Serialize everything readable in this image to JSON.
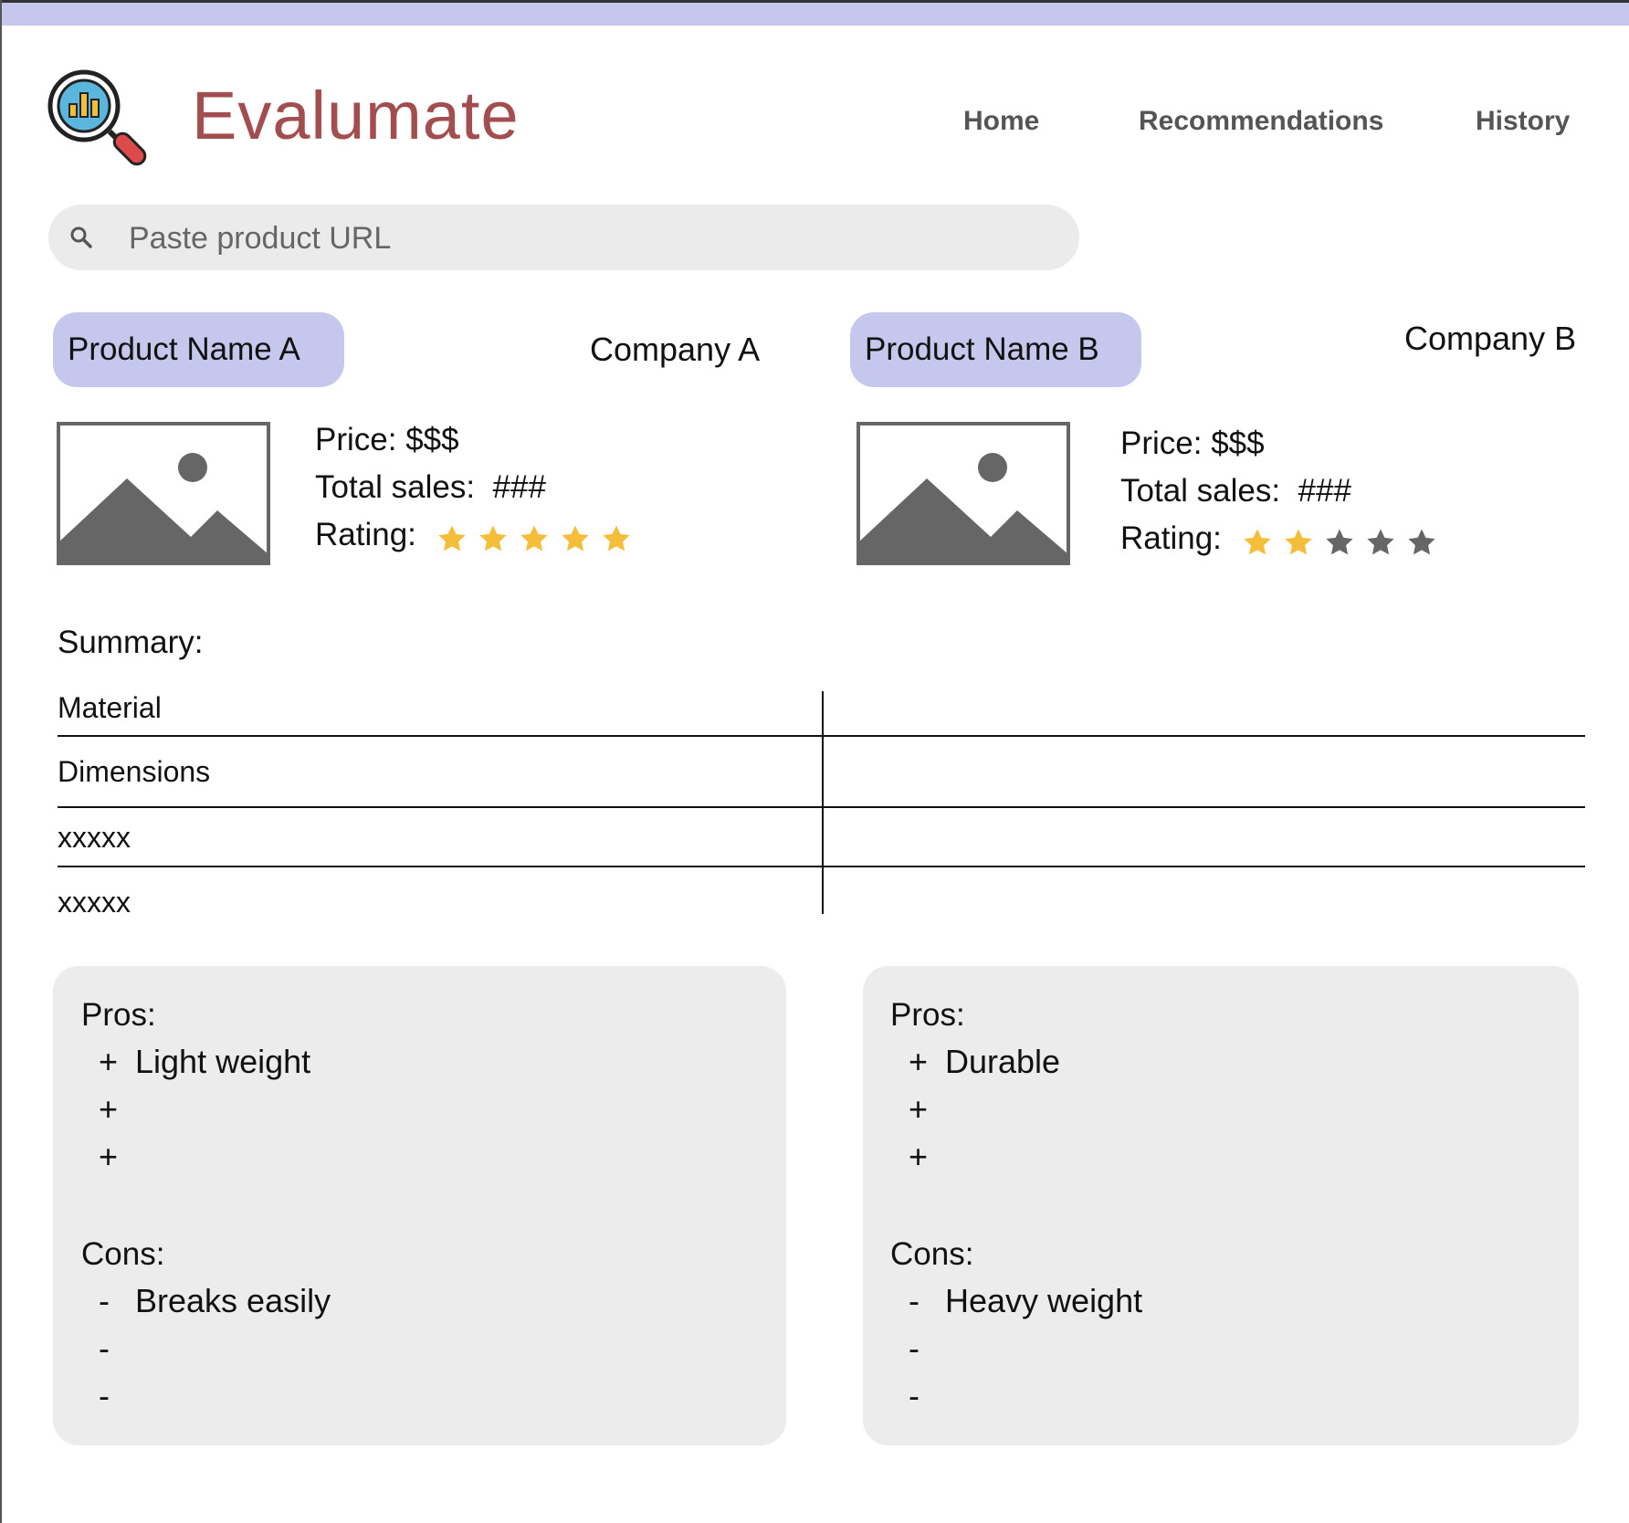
{
  "app": {
    "name": "Evalumate",
    "logo_icon": "magnifier-chart-icon",
    "brand_color": "#a34e4e",
    "accent_color": "#c5c8ec"
  },
  "nav": {
    "home": "Home",
    "recommendations": "Recommendations",
    "history": "History"
  },
  "search": {
    "placeholder": "Paste product URL",
    "value": ""
  },
  "products": [
    {
      "name": "Product Name A",
      "company": "Company A",
      "price_label": "Price:",
      "price": "$$$",
      "sales_label": "Total sales:",
      "sales": "###",
      "rating_label": "Rating:",
      "rating": 5,
      "rating_max": 5
    },
    {
      "name": "Product Name B",
      "company": "Company B",
      "price_label": "Price:",
      "price": "$$$",
      "sales_label": "Total sales:",
      "sales": "###",
      "rating_label": "Rating:",
      "rating": 2,
      "rating_max": 5
    }
  ],
  "summary": {
    "title": "Summary:",
    "rows": [
      "Material",
      "Dimensions",
      "xxxxx",
      "xxxxx"
    ]
  },
  "cards": [
    {
      "pros_title": "Pros:",
      "pros": [
        "Light weight",
        "",
        ""
      ],
      "cons_title": "Cons:",
      "cons": [
        "Breaks easily",
        "",
        ""
      ]
    },
    {
      "pros_title": "Pros:",
      "pros": [
        "Durable",
        "",
        ""
      ],
      "cons_title": "Cons:",
      "cons": [
        "Heavy weight",
        "",
        ""
      ]
    }
  ],
  "colors": {
    "star_filled": "#f5be3a",
    "star_empty": "#666666"
  }
}
